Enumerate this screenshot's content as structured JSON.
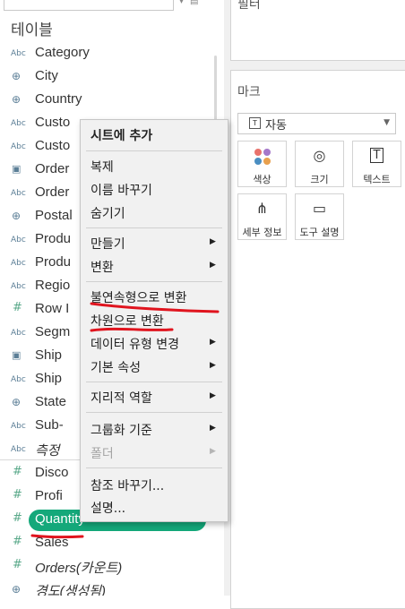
{
  "left_pane": {
    "title": "테이블",
    "fields": [
      {
        "icon": "abc-icon",
        "type": "abc",
        "label": "Category"
      },
      {
        "icon": "globe-icon",
        "type": "globe",
        "label": "City"
      },
      {
        "icon": "globe-icon",
        "type": "globe",
        "label": "Country"
      },
      {
        "icon": "abc-icon",
        "type": "abc",
        "label": "Custo"
      },
      {
        "icon": "abc-icon",
        "type": "abc",
        "label": "Custo"
      },
      {
        "icon": "calendar-icon",
        "type": "cal",
        "label": "Order"
      },
      {
        "icon": "abc-icon",
        "type": "abc",
        "label": "Order"
      },
      {
        "icon": "globe-icon",
        "type": "globe",
        "label": "Postal"
      },
      {
        "icon": "abc-icon",
        "type": "abc",
        "label": "Produ"
      },
      {
        "icon": "abc-icon",
        "type": "abc",
        "label": "Produ"
      },
      {
        "icon": "abc-icon",
        "type": "abc",
        "label": "Regio"
      },
      {
        "icon": "hash-icon",
        "type": "hash",
        "label": "Row I"
      },
      {
        "icon": "abc-icon",
        "type": "abc",
        "label": "Segm"
      },
      {
        "icon": "calendar-icon",
        "type": "cal",
        "label": "Ship"
      },
      {
        "icon": "abc-icon",
        "type": "abc",
        "label": "Ship"
      },
      {
        "icon": "globe-icon",
        "type": "globe",
        "label": "State"
      },
      {
        "icon": "abc-icon",
        "type": "abc",
        "label": "Sub-"
      },
      {
        "icon": "abc-icon",
        "type": "abc",
        "label": "측정",
        "italic": true
      }
    ],
    "measures": [
      {
        "icon": "hash-icon",
        "type": "hash",
        "label": "Disco"
      },
      {
        "icon": "hash-icon",
        "type": "hash",
        "label": "Profi"
      },
      {
        "icon": "hash-icon",
        "type": "hash",
        "label": "Quantity",
        "selected": true
      },
      {
        "icon": "hash-icon",
        "type": "hash",
        "label": "Sales"
      },
      {
        "icon": "hash-icon",
        "type": "hash",
        "label": "Orders(카운트)",
        "italic": true
      },
      {
        "icon": "globe-icon",
        "type": "globe",
        "label": "경도(생성됨)",
        "italic": true
      }
    ]
  },
  "filters_card": {
    "title": "필터"
  },
  "marks_card": {
    "title": "마크",
    "mark_type": "자동",
    "buttons": {
      "color": "색상",
      "size": "크기",
      "text": "텍스트",
      "detail": "세부 정보",
      "tooltip": "도구 설명"
    }
  },
  "context_menu": {
    "add_to_sheet": "시트에 추가",
    "duplicate": "복제",
    "rename": "이름 바꾸기",
    "hide": "숨기기",
    "create": "만들기",
    "transform": "변환",
    "convert_discrete": "불연속형으로 변환",
    "convert_dimension": "차원으로 변환",
    "change_data_type": "데이터 유형 변경",
    "default_properties": "기본 속성",
    "geographic_role": "지리적 역할",
    "group_by": "그룹화 기준",
    "folders": "폴더",
    "replace_references": "참조 바꾸기...",
    "describe": "설명..."
  },
  "colors": {
    "selected_pill": "#14a87a",
    "annotation_red": "#e0141e"
  }
}
